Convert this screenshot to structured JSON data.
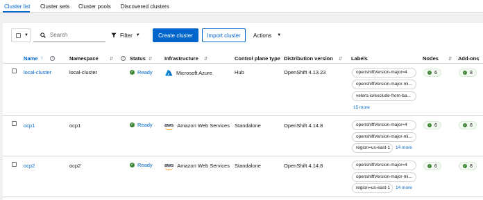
{
  "tabs": [
    {
      "label": "Cluster list",
      "active": true
    },
    {
      "label": "Cluster sets",
      "active": false
    },
    {
      "label": "Cluster pools",
      "active": false
    },
    {
      "label": "Discovered clusters",
      "active": false
    }
  ],
  "toolbar": {
    "search_placeholder": "Search",
    "filter_label": "Filter",
    "create_label": "Create cluster",
    "import_label": "Import cluster",
    "actions_label": "Actions"
  },
  "columns": {
    "name": "Name",
    "namespace": "Namespace",
    "status": "Status",
    "infrastructure": "Infrastructure",
    "control_plane": "Control plane type",
    "distribution": "Distribution version",
    "labels": "Labels",
    "nodes": "Nodes",
    "addons": "Add-ons"
  },
  "rows": [
    {
      "name": "local-cluster",
      "namespace": "local-cluster",
      "status": "Ready",
      "infrastructure": "Microsoft Azure",
      "infra_icon": "azure-icon",
      "control_plane": "Hub",
      "distribution": "OpenShift 4.13.23",
      "labels": [
        "openshiftVersion-major=4",
        "openshiftVersion-major-mi...",
        "velero.io/exclude-from-ba..."
      ],
      "labels_more": "15 more",
      "nodes": "6",
      "addons": "8"
    },
    {
      "name": "ocp1",
      "namespace": "ocp1",
      "status": "Ready",
      "infrastructure": "Amazon Web Services",
      "infra_icon": "aws-icon",
      "control_plane": "Standalone",
      "distribution": "OpenShift 4.14.8",
      "labels": [
        "openshiftVersion-major=4",
        "openshiftVersion-major-mi...",
        "region=us-east-1"
      ],
      "labels_more": "14 more",
      "nodes": "6",
      "addons": "8"
    },
    {
      "name": "ocp2",
      "namespace": "ocp2",
      "status": "Ready",
      "infrastructure": "Amazon Web Services",
      "infra_icon": "aws-icon",
      "control_plane": "Standalone",
      "distribution": "OpenShift 4.14.8",
      "labels": [
        "openshiftVersion-major=4",
        "openshiftVersion-major-mi...",
        "region=us-east-1"
      ],
      "labels_more": "14 more",
      "nodes": "6",
      "addons": "8"
    }
  ],
  "aws_mark": "aws",
  "colors": {
    "accent": "#0066cc",
    "success": "#3e8635",
    "aws_orange": "#ff9900"
  }
}
